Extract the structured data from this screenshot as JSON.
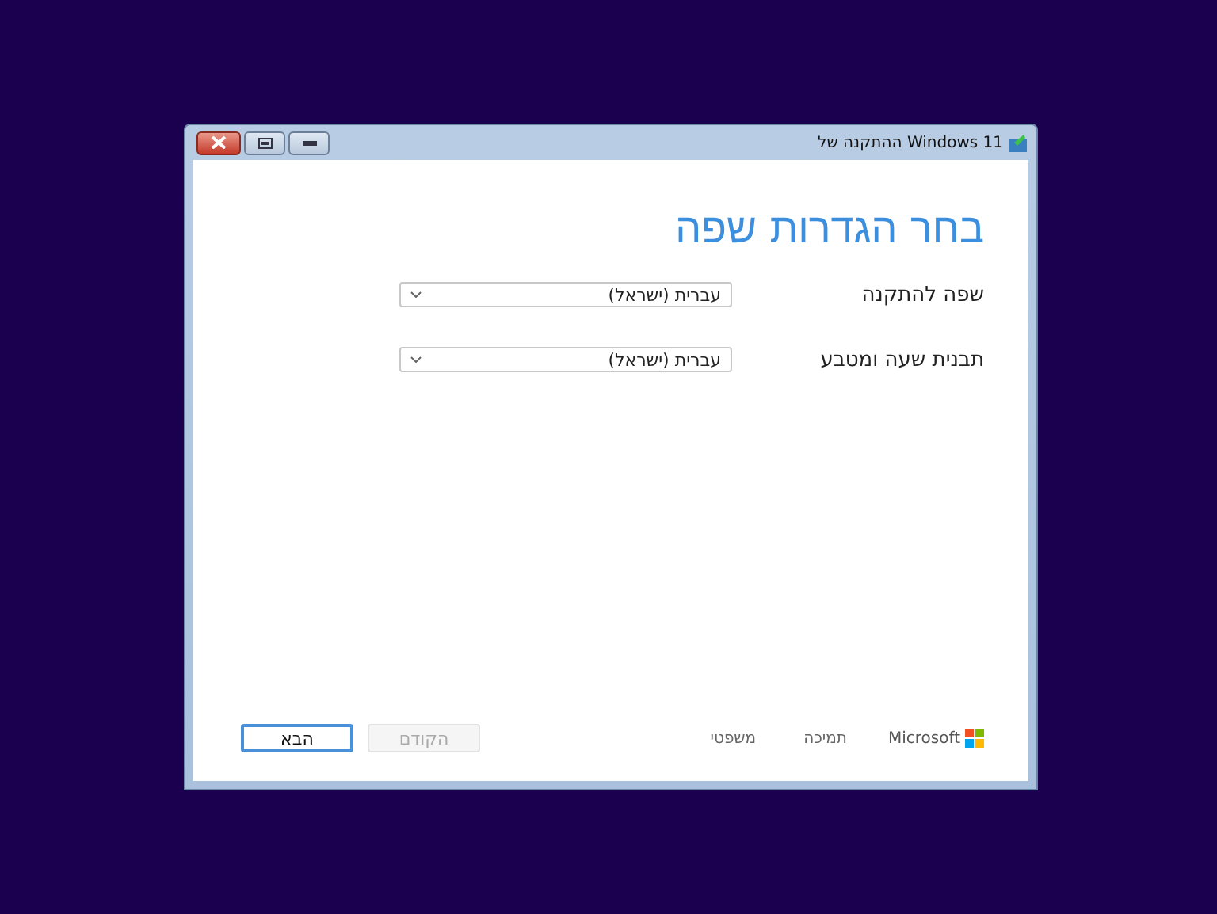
{
  "window": {
    "title": "ההתקנה של Windows 11"
  },
  "heading": "בחר הגדרות שפה",
  "fields": [
    {
      "label": "שפה להתקנה",
      "value": "עברית (ישראל)"
    },
    {
      "label": "תבנית שעה ומטבע",
      "value": "עברית (ישראל)"
    }
  ],
  "footer": {
    "brand": "Microsoft",
    "links": [
      "תמיכה",
      "משפטי"
    ]
  },
  "buttons": [
    {
      "label": "הקודם",
      "disabled": true,
      "focused": false
    },
    {
      "label": "הבא",
      "disabled": false,
      "focused": true
    }
  ]
}
